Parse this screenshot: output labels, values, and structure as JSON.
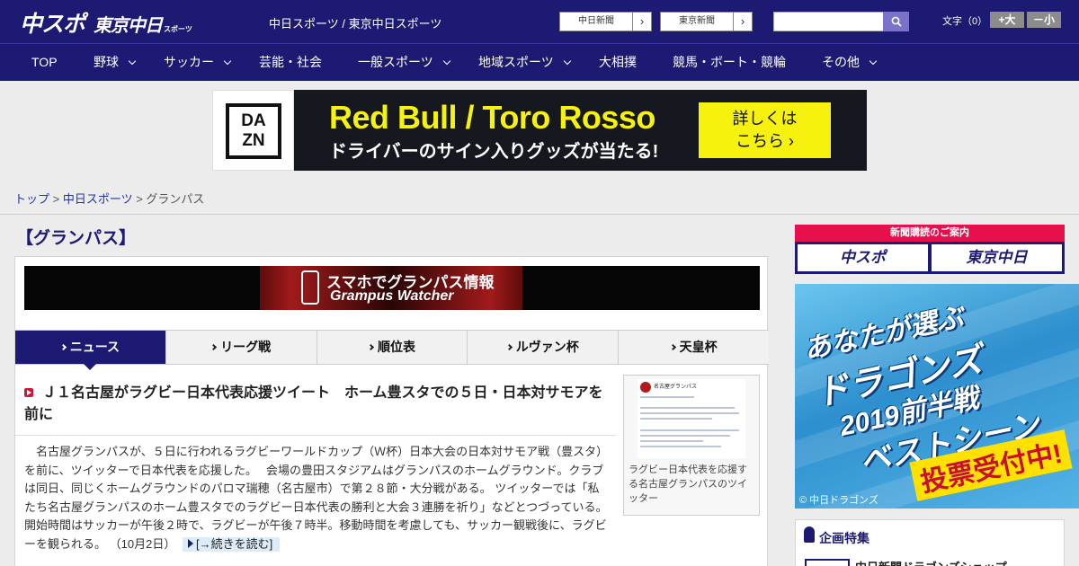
{
  "header": {
    "logo_main": "中スポ",
    "logo_sub": "東京中日",
    "logo_tag": "スポーツ",
    "site_link": "中日スポーツ / 東京中日スポーツ",
    "paper_buttons": [
      "中日新聞",
      "東京新聞"
    ],
    "arrow_glyph": "›",
    "font_label": "文字（0）",
    "font_plus": "+大",
    "font_minus": "－小"
  },
  "nav": {
    "items": [
      {
        "label": "TOP"
      },
      {
        "label": "野球"
      },
      {
        "label": "サッカー"
      },
      {
        "label": "芸能・社会"
      },
      {
        "label": "一般スポーツ"
      },
      {
        "label": "地域スポーツ"
      },
      {
        "label": "大相撲"
      },
      {
        "label": "競馬・ボート・競輪"
      },
      {
        "label": "その他"
      }
    ]
  },
  "ad": {
    "brand_top": "DA",
    "brand_bottom": "ZN",
    "headline": "Red Bull / Toro Rosso",
    "subline": "ドライバーのサイン入りグッズが当たる!",
    "cta_line1": "詳しくは",
    "cta_line2": "こちら ›"
  },
  "breadcrumb": {
    "items": [
      "トップ",
      "中日スポーツ",
      "グランパス"
    ],
    "separator": " > "
  },
  "page_title": "【グランパス】",
  "banner": {
    "line1": "スマホでグランパス情報",
    "line2": "Grampus Watcher"
  },
  "tabs": [
    {
      "label": "ニュース",
      "active": true
    },
    {
      "label": "リーグ戦",
      "active": false
    },
    {
      "label": "順位表",
      "active": false
    },
    {
      "label": "ルヴァン杯",
      "active": false
    },
    {
      "label": "天皇杯",
      "active": false
    }
  ],
  "article": {
    "headline": "Ｊ１名古屋がラグビー日本代表応援ツイート　ホーム豊スタでの５日・日本対サモアを前に",
    "body": "名古屋グランパスが、５日に行われるラグビーワールドカップ（Ｗ杯）日本大会の日本対サモア戦（豊スタ）を前に、ツイッターで日本代表を応援した。　 会場の豊田スタジアムはグランパスのホームグラウンド。クラブは同日、同じくホームグラウンドのパロマ瑞穂（名古屋市）で第２８節・大分戦がある。 ツイッターでは「私たち名古屋グランパスのホーム豊スタでのラグビー日本代表の勝利と大会３連勝を祈り」などとつづっている。 開始時間はサッカーが午後２時で、ラグビーが午後７時半。移動時間を考慮しても、サッカー観戦後に、ラグビーを観られる。",
    "date": "（10月2日）",
    "more_link": "[→続きを読む]",
    "thumb_account": "名古屋グランパス",
    "thumb_caption": "ラグビー日本代表を応援する名古屋グランパスのツイッター"
  },
  "sidebar": {
    "subscribe_bar": "新聞購読のご案内",
    "subscribe_left": "中スポ",
    "subscribe_right": "東京中日",
    "dragons_line1": "あなたが選ぶ",
    "dragons_line2": "ドラゴンズ",
    "dragons_line3": "2019前半戦",
    "dragons_line4": "ベストシーン",
    "dragons_vote": "投票受付中!",
    "dragons_copyright": "© 中日ドラゴンズ",
    "feature_title": "企画特集",
    "feature_item": "中日新聞ドラゴンズショップ"
  },
  "colors": {
    "brand_navy": "#1c1a73",
    "accent_red": "#e5104c",
    "ad_yellow": "#f6f20d"
  }
}
